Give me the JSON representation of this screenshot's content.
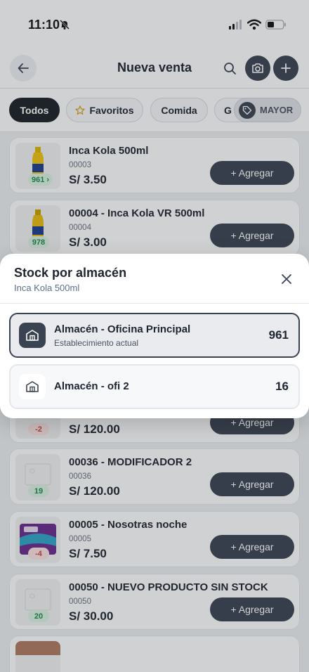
{
  "status_bar": {
    "time": "11:10"
  },
  "header": {
    "title": "Nueva venta"
  },
  "filters": [
    {
      "label": "Todos"
    },
    {
      "label": "Favoritos"
    },
    {
      "label": "Comida"
    },
    {
      "label": "G"
    }
  ],
  "price_tier": {
    "label": "MAYOR"
  },
  "add_label": "+ Agregar",
  "products": [
    {
      "name": "Inca Kola 500ml",
      "code": "00003",
      "price": "S/ 3.50",
      "stock": "961 ›"
    },
    {
      "name": "00004 - Inca Kola VR 500ml",
      "code": "00004",
      "price": "S/ 3.00",
      "stock": "978"
    },
    {
      "name": "",
      "code": "",
      "price": "S/ 120.00",
      "stock": "-2"
    },
    {
      "name": "00036 - MODIFICADOR 2",
      "code": "00036",
      "price": "S/ 120.00",
      "stock": "19"
    },
    {
      "name": "00005 - Nosotras noche",
      "code": "00005",
      "price": "S/ 7.50",
      "stock": "-4"
    },
    {
      "name": "00050 - NUEVO PRODUCTO SIN STOCK",
      "code": "00050",
      "price": "S/ 30.00",
      "stock": "20"
    }
  ],
  "modal": {
    "title": "Stock por almacén",
    "subtitle": "Inca Kola 500ml",
    "warehouses": [
      {
        "name": "Almacén - Oficina Principal",
        "desc": "Establecimiento actual",
        "count": "961"
      },
      {
        "name": "Almacén - ofi 2",
        "count": "16"
      }
    ]
  },
  "colors": {
    "primary_dark": "#3a4352",
    "chip_active": "#1c2128",
    "stock_positive": "#1c8a4a",
    "stock_negative": "#d04545",
    "subtitle_blue": "#5b6e8e"
  }
}
